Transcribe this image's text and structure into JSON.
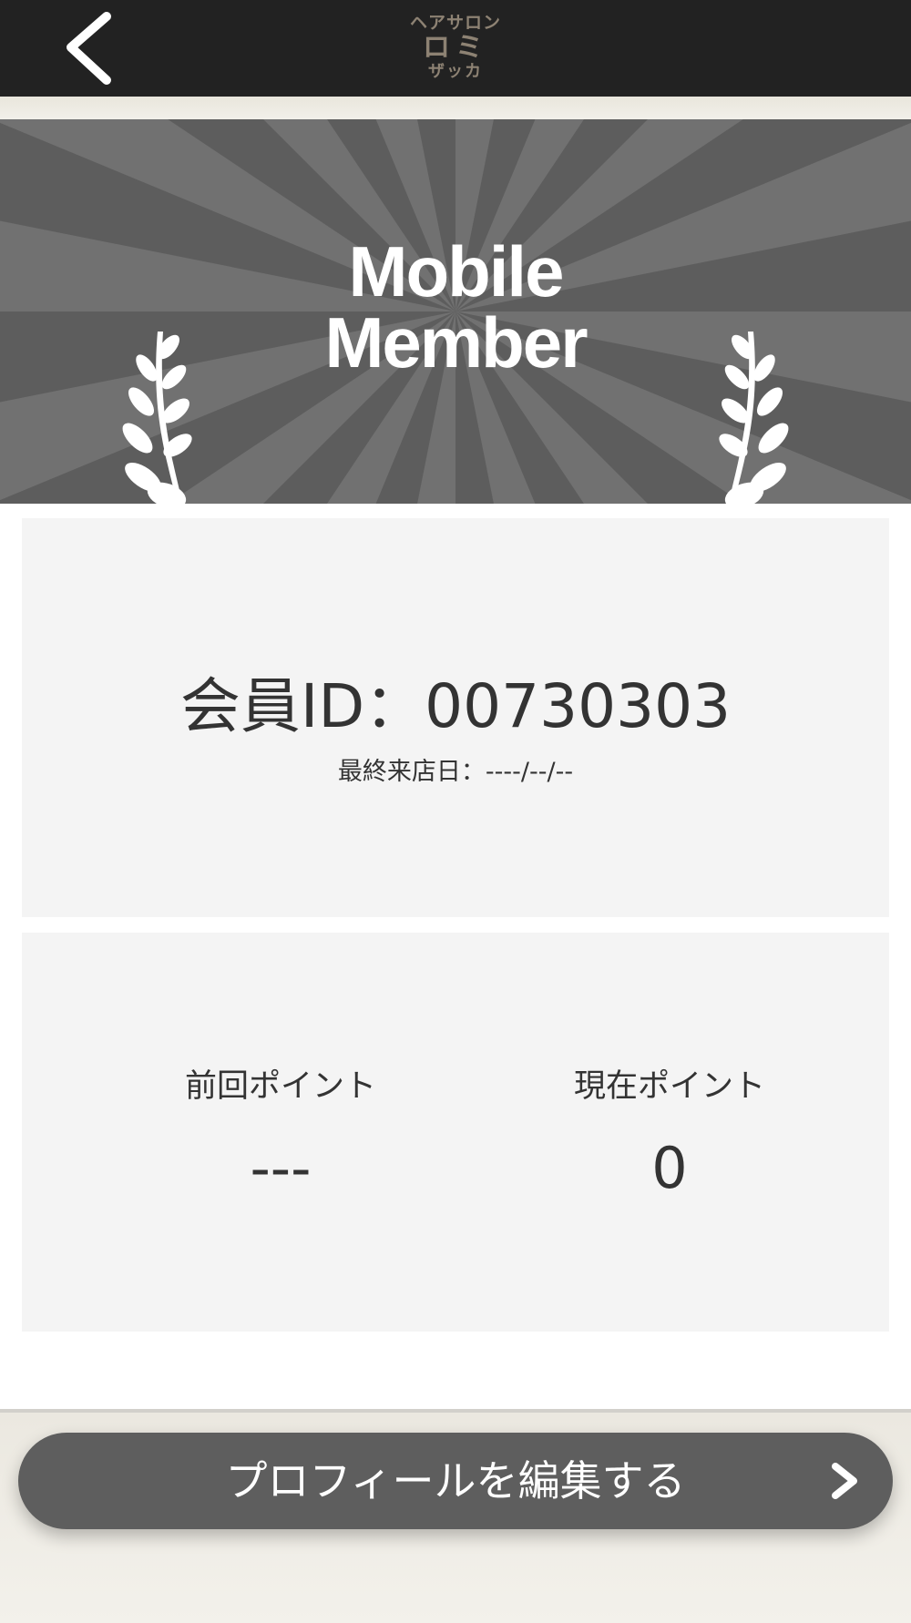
{
  "header": {
    "logo": {
      "line1": "ヘアサロン",
      "line2": "ロミ",
      "line3": "ザッカ"
    },
    "back_icon": "chevron-left-icon"
  },
  "banner": {
    "title_line1": "Mobile",
    "title_line2": "Member",
    "decoration_icon": "laurel-icon",
    "colors": {
      "background": "#5d5d5d",
      "ray": "#717171"
    }
  },
  "member": {
    "id_label": "会員ID：00730303",
    "last_visit": "最終来店日：----/--/--"
  },
  "points": {
    "previous": {
      "label": "前回ポイント",
      "value": "---"
    },
    "current": {
      "label": "現在ポイント",
      "value": "0"
    }
  },
  "footer": {
    "edit_button_label": "プロフィールを編集する",
    "edit_button_icon": "chevron-right-icon",
    "button_color": "#5e5e5e"
  }
}
